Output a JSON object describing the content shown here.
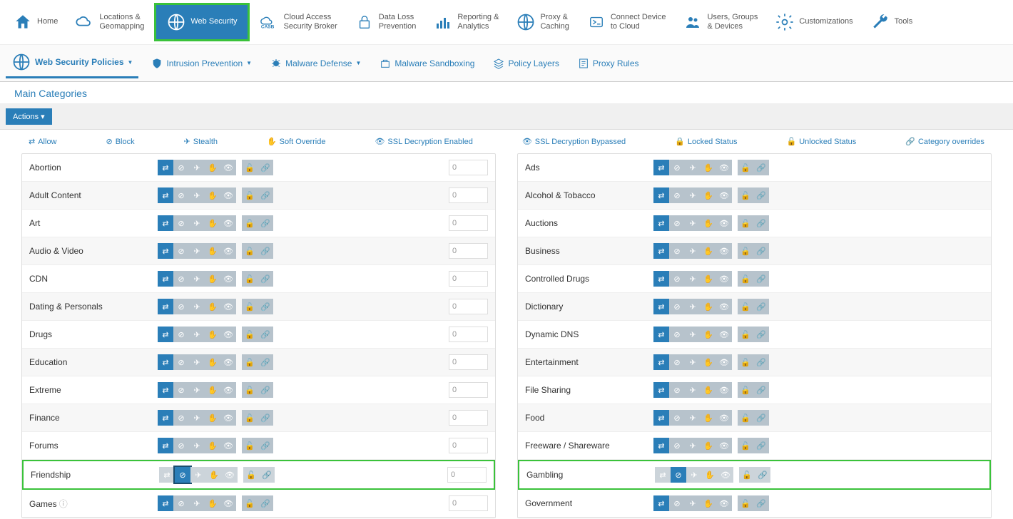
{
  "topNav": [
    {
      "label": "Home",
      "icon": "home"
    },
    {
      "label": "Locations &\nGeomapping",
      "icon": "cloud"
    },
    {
      "label": "Web Security",
      "icon": "globe",
      "active": true
    },
    {
      "label": "Cloud Access\nSecurity Broker",
      "icon": "casb"
    },
    {
      "label": "Data Loss\nPrevention",
      "icon": "lock"
    },
    {
      "label": "Reporting &\nAnalytics",
      "icon": "chart"
    },
    {
      "label": "Proxy &\nCaching",
      "icon": "globe"
    },
    {
      "label": "Connect Device\nto Cloud",
      "icon": "connect"
    },
    {
      "label": "Users, Groups\n& Devices",
      "icon": "users"
    },
    {
      "label": "Customizations",
      "icon": "gear"
    },
    {
      "label": "Tools",
      "icon": "wrench"
    }
  ],
  "subNav": [
    {
      "label": "Web Security Policies",
      "icon": "globe",
      "active": true,
      "dropdown": true
    },
    {
      "label": "Intrusion Prevention",
      "icon": "shield",
      "dropdown": true
    },
    {
      "label": "Malware Defense",
      "icon": "bug",
      "dropdown": true
    },
    {
      "label": "Malware Sandboxing",
      "icon": "sandbox",
      "dropdown": false
    },
    {
      "label": "Policy Layers",
      "icon": "layers",
      "dropdown": false
    },
    {
      "label": "Proxy Rules",
      "icon": "rules",
      "dropdown": false
    }
  ],
  "sectionTitle": "Main Categories",
  "actionsBtn": "Actions ▾",
  "legend": [
    {
      "label": "Allow",
      "icon": "⇄"
    },
    {
      "label": "Block",
      "icon": "⊘"
    },
    {
      "label": "Stealth",
      "icon": "✈"
    },
    {
      "label": "Soft Override",
      "icon": "✋"
    },
    {
      "label": "SSL Decryption Enabled",
      "icon": "👁"
    },
    {
      "label": "SSL Decryption Bypassed",
      "icon": "👁"
    },
    {
      "label": "Locked Status",
      "icon": "🔒"
    },
    {
      "label": "Unlocked Status",
      "icon": "🔓"
    },
    {
      "label": "Category overrides",
      "icon": "🔗"
    }
  ],
  "iconButtons": [
    "⇄",
    "⊘",
    "✈",
    "✋",
    "👁",
    "🔓",
    "🔗"
  ],
  "leftCategories": [
    {
      "name": "Abortion",
      "active": 0,
      "count": "0"
    },
    {
      "name": "Adult Content",
      "active": 0,
      "count": "0"
    },
    {
      "name": "Art",
      "active": 0,
      "count": "0"
    },
    {
      "name": "Audio & Video",
      "active": 0,
      "count": "0"
    },
    {
      "name": "CDN",
      "active": 0,
      "count": "0"
    },
    {
      "name": "Dating & Personals",
      "active": 0,
      "count": "0"
    },
    {
      "name": "Drugs",
      "active": 0,
      "count": "0"
    },
    {
      "name": "Education",
      "active": 0,
      "count": "0"
    },
    {
      "name": "Extreme",
      "active": 0,
      "count": "0"
    },
    {
      "name": "Finance",
      "active": 0,
      "count": "0"
    },
    {
      "name": "Forums",
      "active": 0,
      "count": "0"
    },
    {
      "name": "Friendship",
      "active": 1,
      "count": "0",
      "highlighted": true,
      "blockSelected": true
    },
    {
      "name": "Games",
      "active": 0,
      "count": "0",
      "info": true
    }
  ],
  "rightCategories": [
    {
      "name": "Ads",
      "active": 0
    },
    {
      "name": "Alcohol & Tobacco",
      "active": 0
    },
    {
      "name": "Auctions",
      "active": 0
    },
    {
      "name": "Business",
      "active": 0
    },
    {
      "name": "Controlled Drugs",
      "active": 0
    },
    {
      "name": "Dictionary",
      "active": 0
    },
    {
      "name": "Dynamic DNS",
      "active": 0
    },
    {
      "name": "Entertainment",
      "active": 0
    },
    {
      "name": "File Sharing",
      "active": 0
    },
    {
      "name": "Food",
      "active": 0
    },
    {
      "name": "Freeware / Shareware",
      "active": 0
    },
    {
      "name": "Gambling",
      "active": 1,
      "highlighted": true
    },
    {
      "name": "Government",
      "active": 0
    }
  ]
}
